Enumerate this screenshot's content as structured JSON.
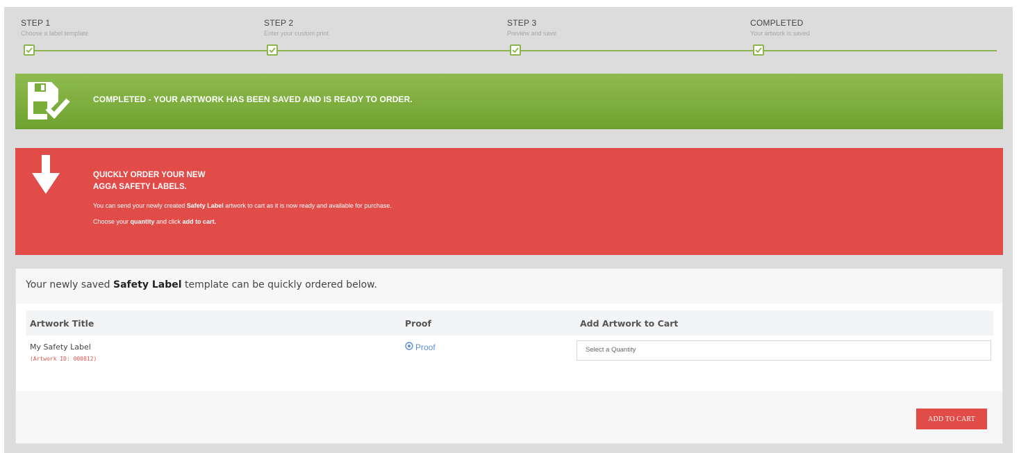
{
  "stepper": {
    "steps": [
      {
        "title": "STEP 1",
        "subtitle": "Choose a label template"
      },
      {
        "title": "STEP 2",
        "subtitle": "Enter your custom print"
      },
      {
        "title": "STEP 3",
        "subtitle": "Preview and save"
      },
      {
        "title": "COMPLETED",
        "subtitle": "Your artwork is saved"
      }
    ]
  },
  "banner_completed": {
    "message": "COMPLETED - YOUR ARTWORK HAS BEEN SAVED AND IS READY TO ORDER.",
    "icon": "save-check-icon",
    "color": "#7aad3a"
  },
  "banner_order": {
    "heading_line1": "QUICKLY ORDER YOUR NEW",
    "heading_line2": "AGGA SAFETY LABELS.",
    "p1_a": "You can send your newly created ",
    "p1_b": "Safety Label",
    "p1_c": " artwork to cart as it is now ready and available for purchase.",
    "p2_a": "Choose your ",
    "p2_b": "quantity",
    "p2_c": " and click ",
    "p2_d": "add to cart.",
    "icon": "arrow-down-icon",
    "color": "#e14b48"
  },
  "panel": {
    "intro_a": "Your newly saved ",
    "intro_b": "Safety Label",
    "intro_c": " template can be quickly ordered below.",
    "columns": [
      "Artwork Title",
      "Proof",
      "Add Artwork to Cart"
    ],
    "row": {
      "title": "My Safety Label",
      "artwork_id": "(Artwork ID: 000812)",
      "proof_label": "Proof",
      "quantity_placeholder": "Select a Quantity"
    },
    "add_to_cart_label": "ADD TO CART"
  }
}
